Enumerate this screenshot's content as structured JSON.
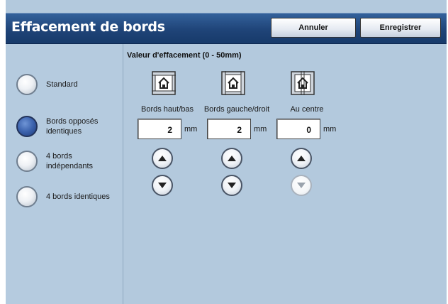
{
  "header": {
    "title": "Effacement de bords",
    "cancel_label": "Annuler",
    "save_label": "Enregistrer"
  },
  "options": [
    {
      "label": "Standard",
      "selected": false
    },
    {
      "label": "Bords opposés identiques",
      "selected": true
    },
    {
      "label": "4 bords indépendants",
      "selected": false
    },
    {
      "label": "4 bords identiques",
      "selected": false
    }
  ],
  "section": {
    "title": "Valeur d'effacement (0 - 50mm)"
  },
  "edges": [
    {
      "label": "Bords haut/bas",
      "value": "2",
      "unit": "mm",
      "icon": "top-bottom-edge-icon",
      "down_enabled": true
    },
    {
      "label": "Bords gauche/droit",
      "value": "2",
      "unit": "mm",
      "icon": "left-right-edge-icon",
      "down_enabled": true
    },
    {
      "label": "Au centre",
      "value": "0",
      "unit": "mm",
      "icon": "center-edge-icon",
      "down_enabled": false
    }
  ]
}
